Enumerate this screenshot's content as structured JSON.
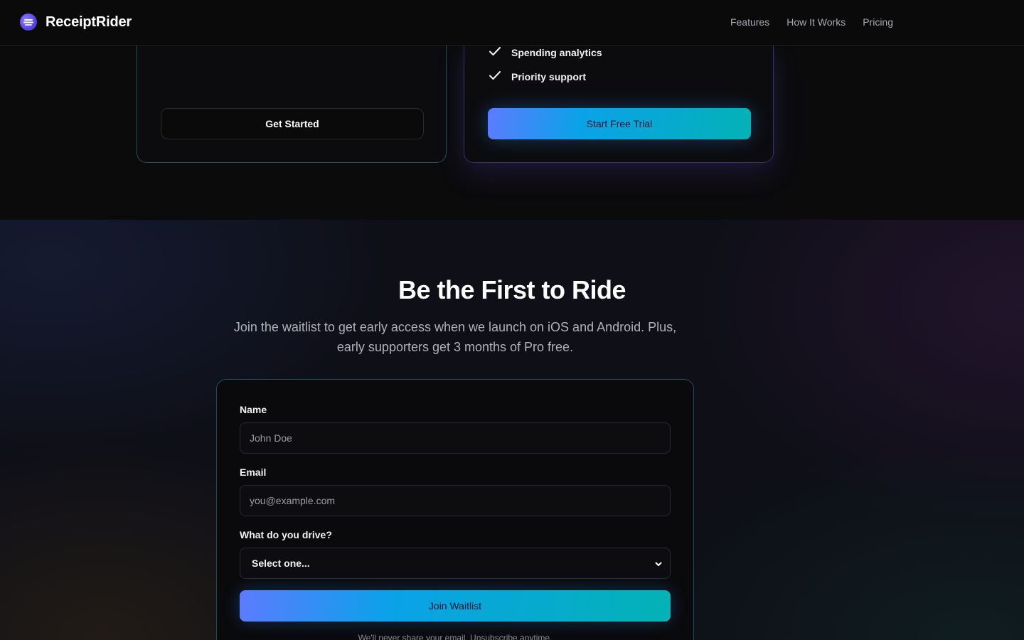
{
  "nav": {
    "brand": "ReceiptRider",
    "links": [
      "Features",
      "How It Works",
      "Pricing"
    ]
  },
  "pricing": {
    "basic": {
      "cta": "Get Started"
    },
    "pro": {
      "features": [
        "Spending analytics",
        "Priority support"
      ],
      "cta": "Start Free Trial"
    }
  },
  "waitlist": {
    "title": "Be the First to Ride",
    "subtitle": "Join the waitlist to get early access when we launch on iOS and Android. Plus, early supporters get 3 months of Pro free.",
    "form": {
      "name_label": "Name",
      "name_placeholder": "John Doe",
      "email_label": "Email",
      "email_placeholder": "you@example.com",
      "vehicle_label": "What do you drive?",
      "vehicle_selected": "Select one...",
      "submit": "Join Waitlist",
      "fine_print": "We'll never share your email. Unsubscribe anytime."
    }
  },
  "colors": {
    "accent_start": "#5d7bff",
    "accent_mid": "#0aa2e8",
    "accent_end": "#03b2b5",
    "background": "#0b0b0c"
  },
  "icons": [
    "logo-icon",
    "check-icon",
    "chevron-down-icon"
  ]
}
